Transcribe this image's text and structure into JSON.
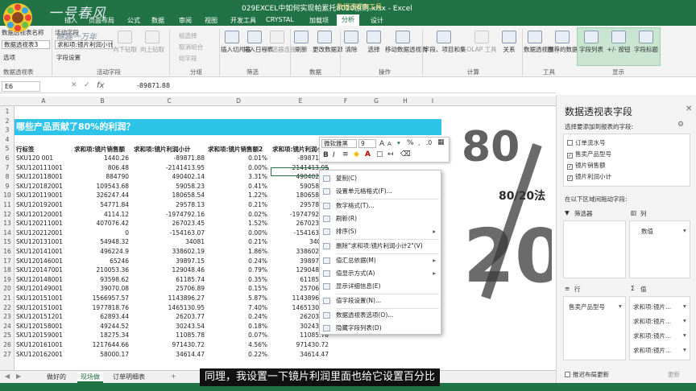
{
  "window": {
    "title": "029EXCEL中如何实现帕累托8020原则.xlsx - Excel",
    "context_tab": "数据透视表工具"
  },
  "brand": {
    "name": "一号春风",
    "slogan": "瞧趣一万年"
  },
  "tabs": [
    "文件",
    "插入",
    "页面布局",
    "公式",
    "数据",
    "审阅",
    "视图",
    "开发工具",
    "CRYSTAL",
    "加载项",
    "分析",
    "设计"
  ],
  "ribbon": {
    "pivot_name_label": "数据透视表名称",
    "pivot_name": "数据透视表3",
    "active_field_label": "活动字段",
    "active_field": "求和项:镜片利润小计",
    "options_label": "选项",
    "field_settings_label": "字段设置",
    "drill_down": "向下钻取",
    "drill_up": "向上钻取",
    "group_selection": "组选择",
    "ungroup": "取消组合",
    "group_field": "组字段",
    "insert_slicer": "插入切片器",
    "insert_timeline": "插入日程表",
    "filter_connections": "筛选器连接",
    "refresh": "刷新",
    "change_source": "更改数据源",
    "clear": "清除",
    "select": "选择",
    "move_pivot": "移动数据透视表",
    "fields_items": "字段、项目和集",
    "olap_tools": "OLAP 工具",
    "relationships": "关系",
    "pivot_chart": "数据透视图",
    "recommended": "推荐的数据透视表",
    "field_list": "字段列表",
    "buttons": "+/- 按钮",
    "headers": "字段标题",
    "groups": {
      "pivot": "数据透视表",
      "active_field": "活动字段",
      "group": "分组",
      "filter": "筛选",
      "data": "数据",
      "actions": "操作",
      "calc": "计算",
      "tools": "工具",
      "show": "显示"
    }
  },
  "formula_bar": {
    "cell": "E6",
    "fx": "fx",
    "value": "-89871.88"
  },
  "columns": [
    "A",
    "B",
    "C",
    "D",
    "E",
    "F",
    "G",
    "H",
    "I"
  ],
  "banner": "哪些产品贡献了80%的利润？",
  "headers": [
    "行标签",
    "求和项:镜片销售额",
    "求和项:镜片利润小计",
    "求和项:镜片销售额2",
    "求和项:镜片利润小计2"
  ],
  "rows": [
    [
      "SKU120 001",
      "1440.26",
      "-89871.88",
      "0.01%",
      "-89871.88"
    ],
    [
      "SKU120111001",
      "806.48",
      "-2141413.95",
      "0.00%",
      "-2141413.95"
    ],
    [
      "SKU120118001",
      "884790",
      "490402.14",
      "3.31%",
      "490402.14"
    ],
    [
      "SKU120182001",
      "109543.68",
      "59058.23",
      "0.41%",
      "59058.23"
    ],
    [
      "SKU120119001",
      "326247.44",
      "180658.54",
      "1.22%",
      "180658.54"
    ],
    [
      "SKU120192001",
      "54771.84",
      "29578.13",
      "0.21%",
      "29578.13"
    ],
    [
      "SKU120120001",
      "4114.12",
      "-1974792.16",
      "0.02%",
      "-1974792.16"
    ],
    [
      "SKU120211001",
      "407076.42",
      "267023.45",
      "1.52%",
      "267023.45"
    ],
    [
      "SKU120212001",
      "0",
      "-154163.07",
      "0.00%",
      "-154163.07"
    ],
    [
      "SKU120131001",
      "54948.32",
      "34081",
      "0.21%",
      "34081"
    ],
    [
      "SKU120141001",
      "496224.9",
      "338602.19",
      "1.86%",
      "338602.19"
    ],
    [
      "SKU120146001",
      "65246",
      "39897.15",
      "0.24%",
      "39897.15"
    ],
    [
      "SKU120147001",
      "210053.36",
      "129048.46",
      "0.79%",
      "129048.46"
    ],
    [
      "SKU120148001",
      "93598.62",
      "61185.74",
      "0.35%",
      "61185.74"
    ],
    [
      "SKU120149001",
      "39070.08",
      "25706.89",
      "0.15%",
      "25706.89"
    ],
    [
      "SKU120151001",
      "1566957.57",
      "1143896.27",
      "5.87%",
      "1143896.27"
    ],
    [
      "SKU120151001",
      "1977818.76",
      "1465130.95",
      "7.40%",
      "1465130.95"
    ],
    [
      "SKU120151201",
      "62893.44",
      "26203.77",
      "0.24%",
      "26203.77"
    ],
    [
      "SKU120158001",
      "49244.52",
      "30243.54",
      "0.18%",
      "30243.54"
    ],
    [
      "SKU120159001",
      "18275.34",
      "11085.78",
      "0.07%",
      "11085.78"
    ],
    [
      "SKU120161001",
      "1217644.66",
      "971430.72",
      "4.56%",
      "971430.72"
    ],
    [
      "SKU120162001",
      "58000.17",
      "34614.47",
      "0.22%",
      "34614.47"
    ]
  ],
  "row_numbers": [
    "1",
    "2",
    "3",
    "4",
    "5",
    "6",
    "7",
    "8",
    "9",
    "10",
    "11",
    "12",
    "13",
    "14",
    "15",
    "16",
    "17",
    "18",
    "19",
    "20",
    "21",
    "22",
    "23",
    "24",
    "25",
    "26",
    "27"
  ],
  "deco": {
    "big1": "80",
    "mid": "80/20法",
    "big2": "20"
  },
  "mini_toolbar": {
    "font": "微软雅黑",
    "size": "9",
    "percent": "%",
    "bold": "B",
    "italic": "I"
  },
  "context_menu": [
    {
      "label": "复制(C)",
      "arrow": ""
    },
    {
      "label": "设置单元格格式(F)...",
      "arrow": ""
    },
    {
      "label": "数字格式(T)...",
      "arrow": ""
    },
    {
      "label": "刷新(R)",
      "arrow": ""
    },
    {
      "label": "排序(S)",
      "arrow": "▸"
    },
    {
      "label": "删除\"求和项:镜片利润小计2\"(V)",
      "arrow": ""
    },
    {
      "label": "值汇总依据(M)",
      "arrow": "▸"
    },
    {
      "label": "值显示方式(A)",
      "arrow": "▸"
    },
    {
      "label": "显示详细信息(E)",
      "arrow": ""
    },
    {
      "label": "值字段设置(N)...",
      "arrow": ""
    },
    {
      "label": "数据透视表选项(O)...",
      "arrow": ""
    },
    {
      "label": "隐藏字段列表(D)",
      "arrow": ""
    }
  ],
  "sheet_tabs": [
    "做好的",
    "现场做",
    "订单明细表"
  ],
  "sheet_add": "+",
  "panel": {
    "title": "数据透视表字段",
    "choose": "选择要添加到报表的字段:",
    "fields": [
      {
        "label": "订单流水号",
        "checked": false
      },
      {
        "label": "售卖产品型号",
        "checked": true
      },
      {
        "label": "镜片销售额",
        "checked": true
      },
      {
        "label": "镜片利润小计",
        "checked": true
      }
    ],
    "drag_hint": "在以下区域间拖动字段:",
    "filter": "筛选器",
    "columns": "列",
    "rows": "行",
    "values": "值",
    "col_value": "数值",
    "row_field": "售卖产品型号",
    "value_fields": [
      "求和项:镜片...",
      "求和项:镜片...",
      "求和项:镜片...",
      "求和项:镜片..."
    ],
    "defer": "推迟布局更新",
    "update": "更新"
  },
  "subtitle": "同理，我设置一下镜片利润里面也给它设置百分比"
}
